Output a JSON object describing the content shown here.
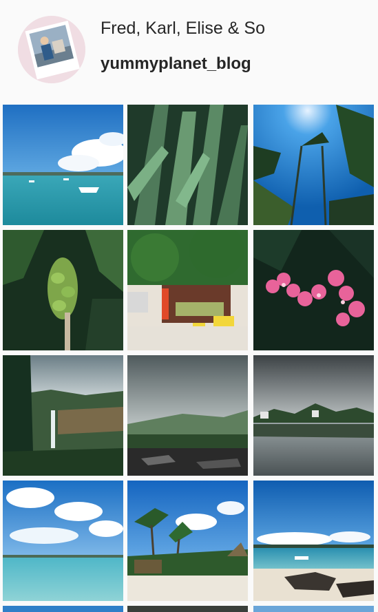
{
  "profile": {
    "group_name": "Fred, Karl, Elise & So",
    "username": "yummyplanet_blog",
    "avatar_icon": "profile-photo"
  },
  "photos": [
    {
      "subject": "harbor-with-boats"
    },
    {
      "subject": "agave-leaves"
    },
    {
      "subject": "palm-trees-blue-sky"
    },
    {
      "subject": "banana-bunch"
    },
    {
      "subject": "roadside-fruit-stall"
    },
    {
      "subject": "pink-frangipani-flowers"
    },
    {
      "subject": "waterfall-gorge"
    },
    {
      "subject": "cloudy-valley-lake"
    },
    {
      "subject": "lake-reflection"
    },
    {
      "subject": "turquoise-lagoon"
    },
    {
      "subject": "palm-beach-huts"
    },
    {
      "subject": "beach-with-rocks"
    }
  ]
}
